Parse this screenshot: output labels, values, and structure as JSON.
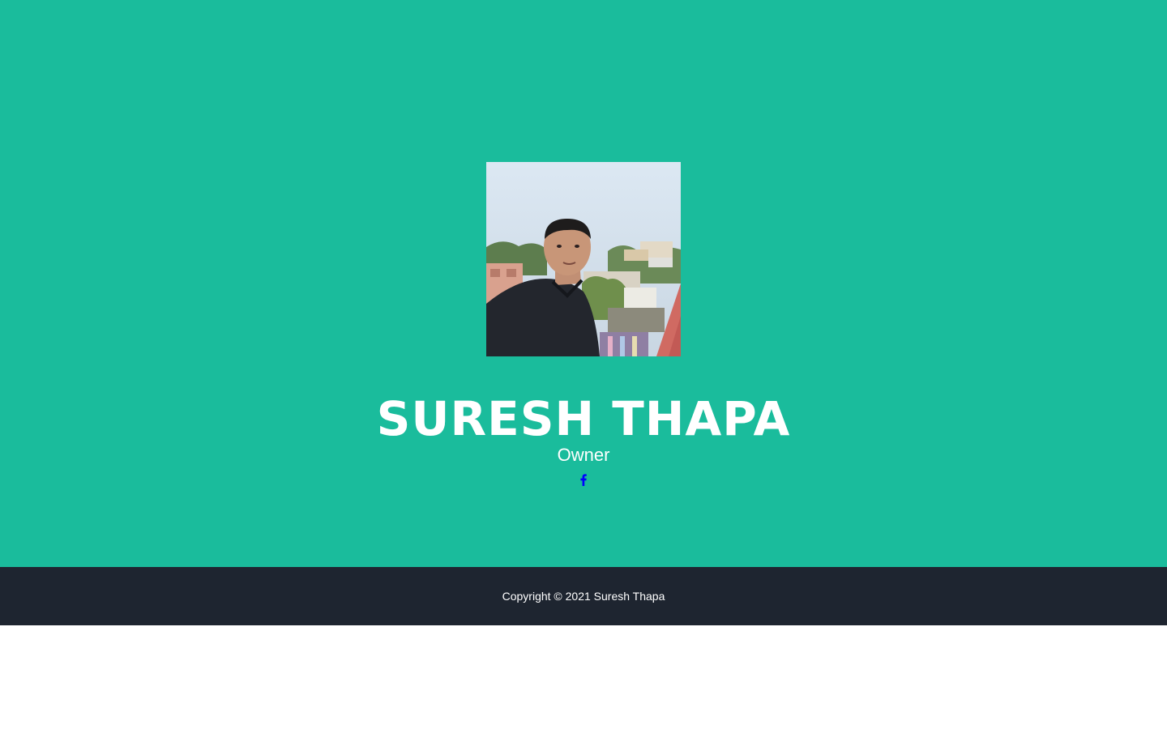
{
  "profile": {
    "name": "SURESH THAPA",
    "role": "Owner",
    "photo_alt": "Suresh Thapa",
    "social": {
      "icon": "facebook-icon",
      "color": "#0000ff"
    }
  },
  "footer": {
    "copyright": "Copyright © 2021 Suresh Thapa"
  },
  "colors": {
    "masthead": "#1abc9c",
    "footer": "#1e2530",
    "text": "#ffffff"
  }
}
